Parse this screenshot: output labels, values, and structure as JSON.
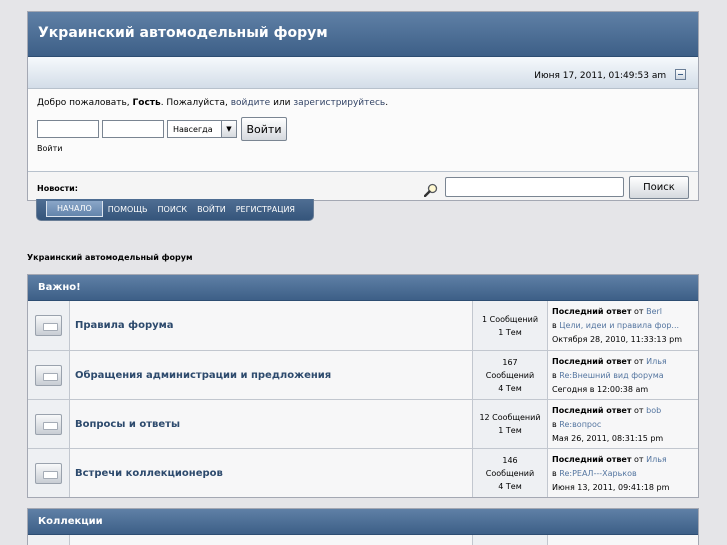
{
  "header": {
    "title": "Украинский автомодельный форум",
    "datetime": "Июня 17, 2011, 01:49:53 am"
  },
  "login": {
    "greet_prefix": "Добро пожаловать, ",
    "guest": "Гость",
    "greet_mid": ". Пожалуйста, ",
    "login_link": "войдите",
    "or": " или ",
    "register_link": "зарегистрируйтесь",
    "greet_end": ".",
    "duration_option": "Навсегда",
    "login_button": "Войти",
    "login_caption": "Войти"
  },
  "news": {
    "label": "Новости:",
    "search_button": "Поиск"
  },
  "nav": [
    "Начало",
    "Помощь",
    "Поиск",
    "Войти",
    "Регистрация"
  ],
  "forum_heading": "Украинский автомодельный форум",
  "categories": [
    {
      "title": "Важно!",
      "boards": [
        {
          "name": "Правила форума",
          "stats": [
            "1 Сообщений",
            "1 Тем"
          ],
          "last_label": "Последний ответ",
          "by": " от ",
          "author": "Berl",
          "in": "в ",
          "topic": "Цели, идеи и правила фор...",
          "date": "Октября 28, 2010, 11:33:13 pm"
        },
        {
          "name": "Обращения администрации и предложения",
          "stats": [
            "167",
            "Сообщений",
            "4 Тем"
          ],
          "last_label": "Последний ответ",
          "by": " от ",
          "author": "Илья",
          "in": "в ",
          "topic": "Re:Внешний вид форума",
          "date": "Сегодня в 12:00:38 am"
        },
        {
          "name": "Вопросы и ответы",
          "stats": [
            "12 Сообщений",
            "1 Тем"
          ],
          "last_label": "Последний ответ",
          "by": " от ",
          "author": "bob",
          "in": "в ",
          "topic": "Re:вопрос",
          "date": "Мая 26, 2011, 08:31:15 pm"
        },
        {
          "name": "Встречи коллекционеров",
          "stats": [
            "146",
            "Сообщений",
            "4 Тем"
          ],
          "last_label": "Последний ответ",
          "by": " от ",
          "author": "Илья",
          "in": "в ",
          "topic": "Re:РЕАЛ---Харьков",
          "date": "Июня 13, 2011, 09:41:18 pm"
        }
      ]
    },
    {
      "title": "Коллекции",
      "boards": []
    }
  ]
}
